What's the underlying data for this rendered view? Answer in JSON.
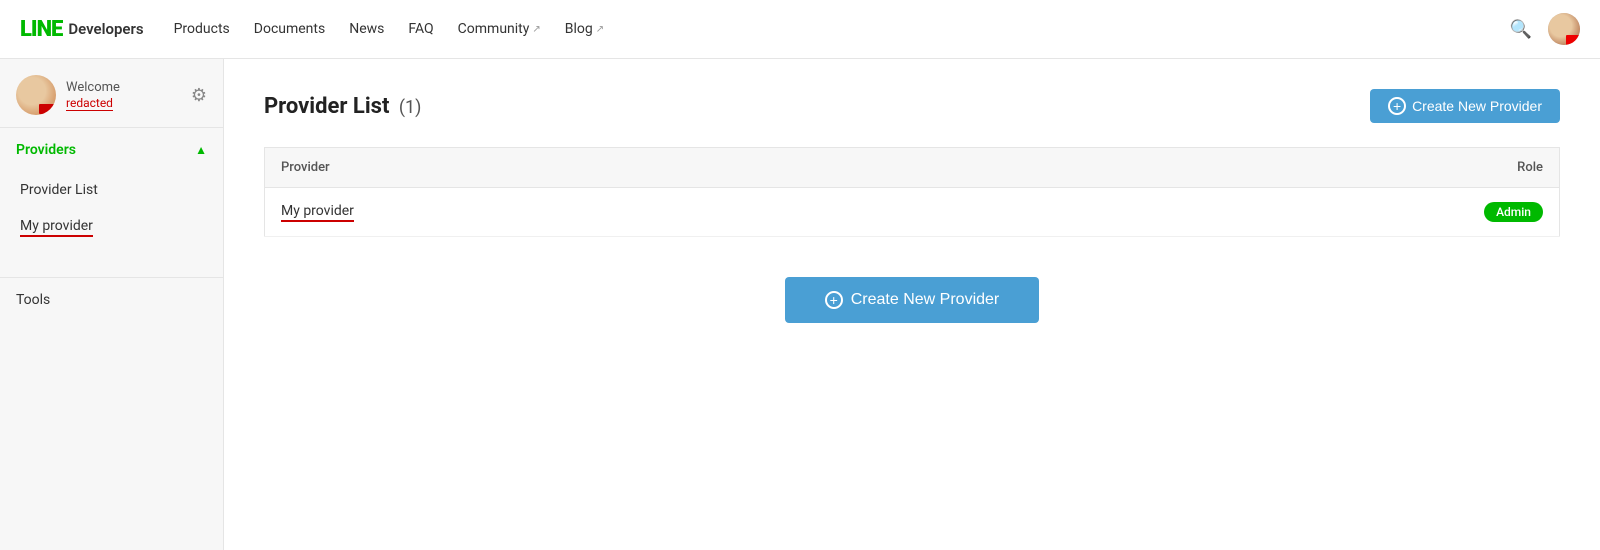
{
  "topnav": {
    "logo_line": "LINE",
    "logo_developers": "Developers",
    "nav_items": [
      {
        "label": "Products",
        "external": false
      },
      {
        "label": "Documents",
        "external": false
      },
      {
        "label": "News",
        "external": false
      },
      {
        "label": "FAQ",
        "external": false
      },
      {
        "label": "Community",
        "external": true
      },
      {
        "label": "Blog",
        "external": true
      }
    ]
  },
  "sidebar": {
    "welcome_label": "Welcome",
    "username": "redacted",
    "section_title": "Providers",
    "nav_items": [
      {
        "label": "Provider List",
        "active": false
      },
      {
        "label": "My provider",
        "active": true,
        "underlined": true
      }
    ],
    "tools_label": "Tools",
    "gear_icon": "⚙"
  },
  "main": {
    "page_title": "Provider List",
    "provider_count": "(1)",
    "create_btn_label": "Create New Provider",
    "table": {
      "col_provider": "Provider",
      "col_role": "Role",
      "rows": [
        {
          "name": "My provider",
          "role": "Admin"
        }
      ]
    },
    "center_create_label": "Create New Provider"
  }
}
